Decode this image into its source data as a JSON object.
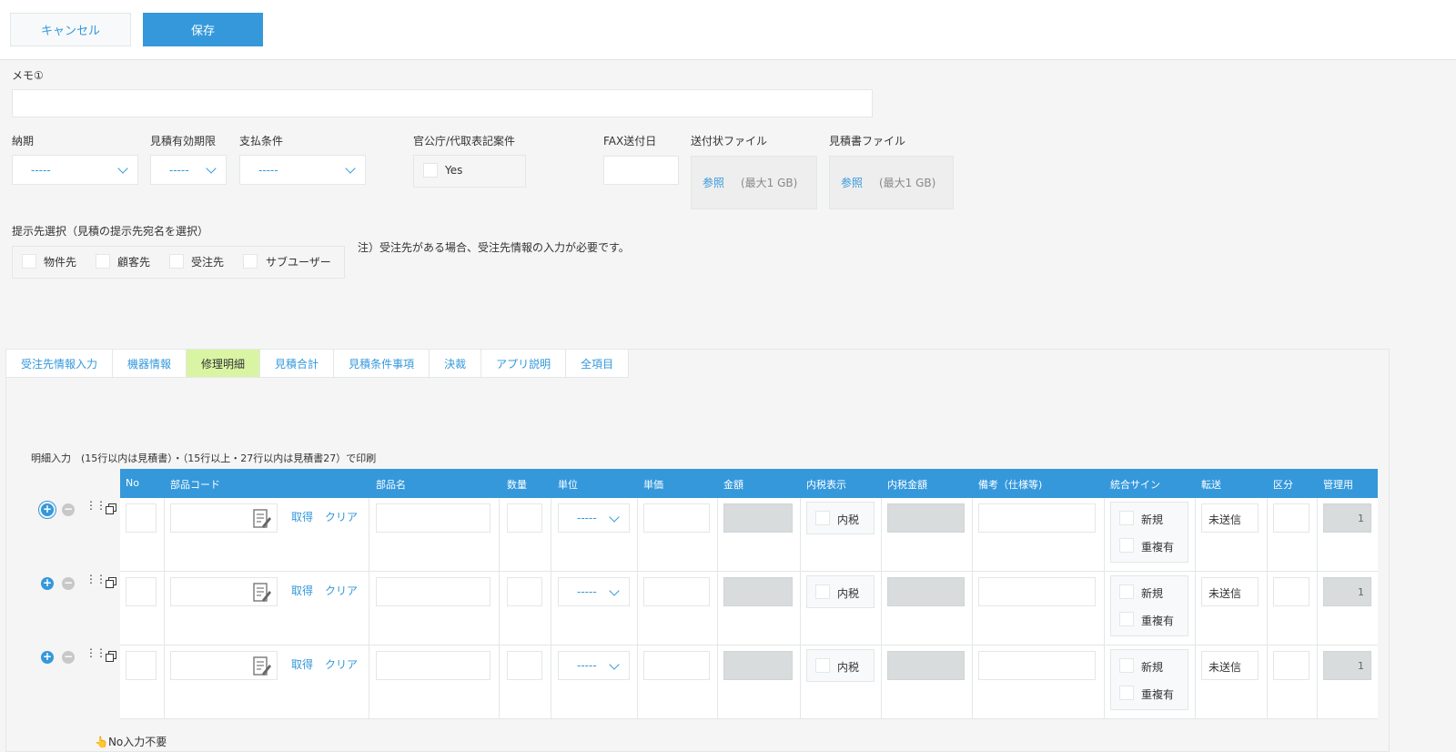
{
  "toolbar": {
    "cancel_label": "キャンセル",
    "save_label": "保存"
  },
  "memo": {
    "label": "メモ①",
    "value": ""
  },
  "fields": {
    "delivery": {
      "label": "納期",
      "value": "-----"
    },
    "validity": {
      "label": "見積有効期限",
      "value": "-----"
    },
    "payment": {
      "label": "支払条件",
      "value": "-----"
    },
    "government": {
      "label": "官公庁/代取表記案件",
      "option": "Yes"
    },
    "fax_date": {
      "label": "FAX送付日",
      "value": ""
    },
    "cover_file": {
      "label": "送付状ファイル",
      "browse": "参照",
      "max": "(最大1 GB)"
    },
    "estimate_file": {
      "label": "見積書ファイル",
      "browse": "参照",
      "max": "(最大1 GB)"
    }
  },
  "recipients": {
    "label": "提示先選択（見積の提示先宛名を選択）",
    "options": [
      "物件先",
      "顧客先",
      "受注先",
      "サブユーザー"
    ],
    "note": "注）受注先がある場合、受注先情報の入力が必要です。"
  },
  "tabs": [
    "受注先情報入力",
    "機器情報",
    "修理明細",
    "見積合計",
    "見積条件事項",
    "決裁",
    "アプリ説明",
    "全項目"
  ],
  "active_tab": "修理明細",
  "table": {
    "caption": "明細入力　(15行以内は見積書）・（15行以上・27行以内は見積書27）で印刷",
    "headers": [
      "No",
      "部品コード",
      "部品名",
      "数量",
      "単位",
      "単価",
      "金額",
      "内税表示",
      "内税金額",
      "備考（仕様等)",
      "統合サイン",
      "転送",
      "区分",
      "管理用"
    ],
    "rows": [
      {
        "get": "取得",
        "clear": "クリア",
        "unit": "-----",
        "tax": "内税",
        "new": "新規",
        "dup": "重複有",
        "transfer": "未送信",
        "mgmt": "1"
      },
      {
        "get": "取得",
        "clear": "クリア",
        "unit": "-----",
        "tax": "内税",
        "new": "新規",
        "dup": "重複有",
        "transfer": "未送信",
        "mgmt": "1"
      },
      {
        "get": "取得",
        "clear": "クリア",
        "unit": "-----",
        "tax": "内税",
        "new": "新規",
        "dup": "重複有",
        "transfer": "未送信",
        "mgmt": "1"
      }
    ],
    "footnote": "👆No入力不要"
  },
  "icons": {
    "add": "plus-circle-icon",
    "remove": "minus-circle-icon",
    "drag": "drag-handle-icon",
    "copy": "copy-icon",
    "lookup": "edit-note-icon"
  }
}
